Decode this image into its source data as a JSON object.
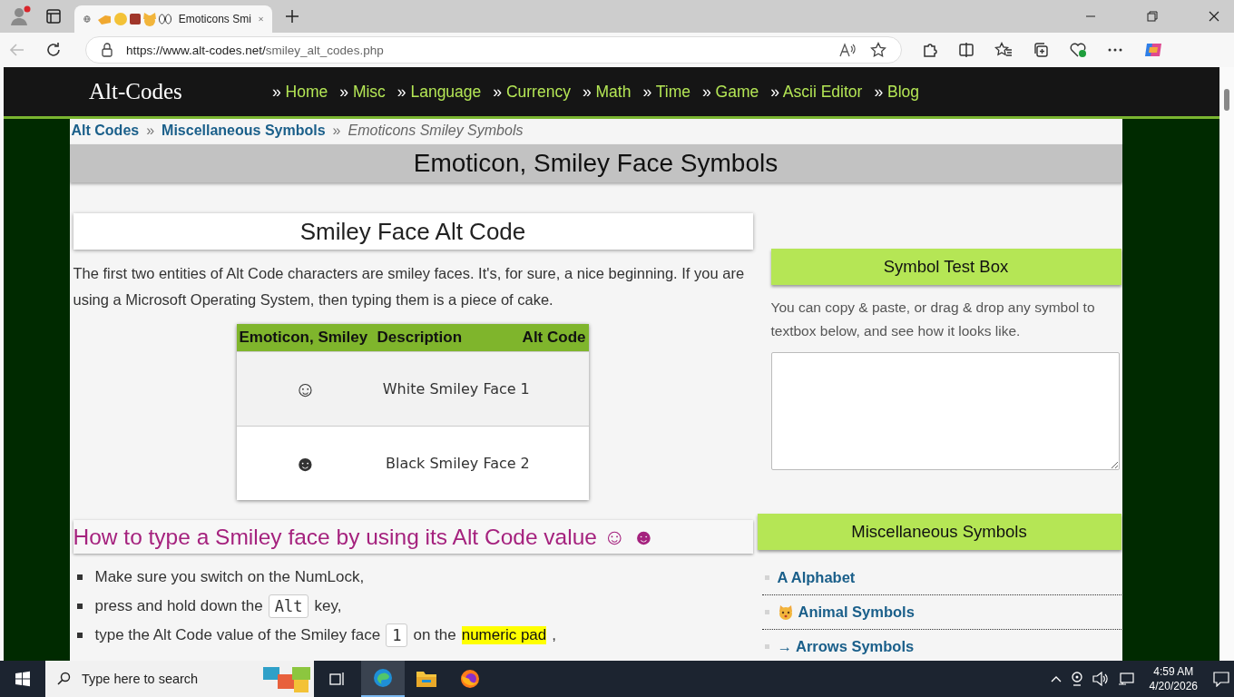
{
  "browser": {
    "tabs": [
      {
        "title": "Emoticons Smi",
        "selected": true
      }
    ],
    "url_host": "https://www.alt-codes.net/",
    "url_path": "smiley_alt_codes.php"
  },
  "site": {
    "logo": "Alt-Codes",
    "nav": [
      {
        "marker": "»",
        "label": "Home"
      },
      {
        "marker": "»",
        "label": "Misc"
      },
      {
        "marker": "»",
        "label": "Language"
      },
      {
        "marker": "»",
        "label": "Currency"
      },
      {
        "marker": "»",
        "label": "Math"
      },
      {
        "marker": "»",
        "label": "Time"
      },
      {
        "marker": "»",
        "label": "Game"
      },
      {
        "marker": "»",
        "label": "Ascii Editor"
      },
      {
        "marker": "»",
        "label": "Blog"
      }
    ]
  },
  "breadcrumb": [
    {
      "label": "Alt Codes",
      "kind": "link"
    },
    {
      "label": "»",
      "kind": "sep"
    },
    {
      "label": "Miscellaneous Symbols",
      "kind": "link"
    },
    {
      "label": "»",
      "kind": "sep"
    },
    {
      "label": "Emoticons Smiley Symbols",
      "kind": "current"
    }
  ],
  "page_title": "Emoticon, Smiley Face Symbols",
  "section": {
    "heading": "Smiley Face Alt Code",
    "paragraph": "The first two entities of Alt Code characters are smiley faces. It's, for sure, a nice beginning. If you are using a Microsoft Operating System, then typing them is a piece of cake.",
    "table": {
      "columns": [
        "Emoticon, Smiley",
        "Description",
        "Alt Code"
      ],
      "rows": [
        {
          "symbol": "☺",
          "description": "White Smiley Face",
          "alt_code": "1"
        },
        {
          "symbol": "☻",
          "description": "Black Smiley Face",
          "alt_code": "2"
        }
      ]
    }
  },
  "howto": {
    "heading": "How to type a Smiley face by using its Alt Code value ☺ ☻",
    "steps": [
      [
        {
          "kind": "text",
          "text": "Make sure you switch on the NumLock,"
        }
      ],
      [
        {
          "kind": "text",
          "text": "press and hold down the"
        },
        {
          "kind": "key",
          "text": "Alt"
        },
        {
          "kind": "text",
          "text": "key,"
        }
      ],
      [
        {
          "kind": "text",
          "text": "type the Alt Code value of the Smiley face"
        },
        {
          "kind": "key",
          "text": "1"
        },
        {
          "kind": "text",
          "text": "on the"
        },
        {
          "kind": "highlight",
          "text": "numeric pad"
        },
        {
          "kind": "text",
          "text": ","
        }
      ]
    ]
  },
  "test_box": {
    "heading": "Symbol Test Box",
    "text": "You can copy & paste, or drag & drop any symbol to textbox below, and see how it looks like."
  },
  "misc": {
    "heading": "Miscellaneous Symbols",
    "items": [
      {
        "label": "A Alphabet",
        "kind": "text"
      },
      {
        "label": "Animal Symbols",
        "kind": "emoji"
      },
      {
        "label": "→ Arrows Symbols",
        "kind": "text"
      }
    ]
  },
  "taskbar": {
    "search_placeholder": "Type here to search",
    "time": "4:59 AM",
    "date": "4/20/2026"
  }
}
